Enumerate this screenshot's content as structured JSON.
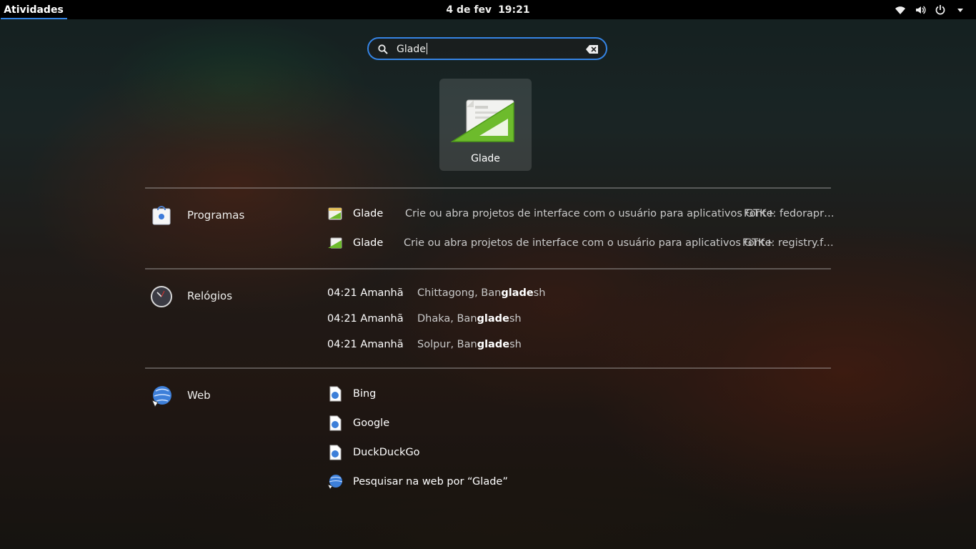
{
  "topbar": {
    "activities": "Atividades",
    "date": "4 de fev",
    "time": "19:21",
    "icons": [
      "network-wireless-icon",
      "volume-icon",
      "power-icon",
      "chevron-down-icon"
    ]
  },
  "search": {
    "value": "Glade",
    "icon": "search-icon",
    "clear_icon": "edit-clear-icon"
  },
  "top_result": {
    "label": "Glade",
    "icon": "glade-app-icon"
  },
  "providers": {
    "programs": {
      "name": "Programas",
      "icon": "software-center-icon",
      "items": [
        {
          "title": "Glade",
          "description": "Crie ou abra projetos de interface com o usuário para aplicativos GTK+",
          "source": "Fonte: fedorapr…"
        },
        {
          "title": "Glade",
          "description": "Crie ou abra projetos de interface com o usuário para aplicativos GTK+",
          "source": "Fonte: registry.f…"
        }
      ]
    },
    "clocks": {
      "name": "Relógios",
      "icon": "clock-icon",
      "items": [
        {
          "time": "04:21 Amanhã",
          "pre": "Chittagong, Ban",
          "match": "glade",
          "post": "sh"
        },
        {
          "time": "04:21 Amanhã",
          "pre": "Dhaka, Ban",
          "match": "glade",
          "post": "sh"
        },
        {
          "time": "04:21 Amanhã",
          "pre": "Solpur, Ban",
          "match": "glade",
          "post": "sh"
        }
      ]
    },
    "web": {
      "name": "Web",
      "icon": "web-browser-icon",
      "items": [
        {
          "title": "Bing"
        },
        {
          "title": "Google"
        },
        {
          "title": "DuckDuckGo"
        },
        {
          "title": "Pesquisar na web por “Glade”"
        }
      ]
    }
  },
  "colors": {
    "accent": "#3584e4",
    "topbar": "#000000",
    "glade_green": "#6dbb2c"
  }
}
